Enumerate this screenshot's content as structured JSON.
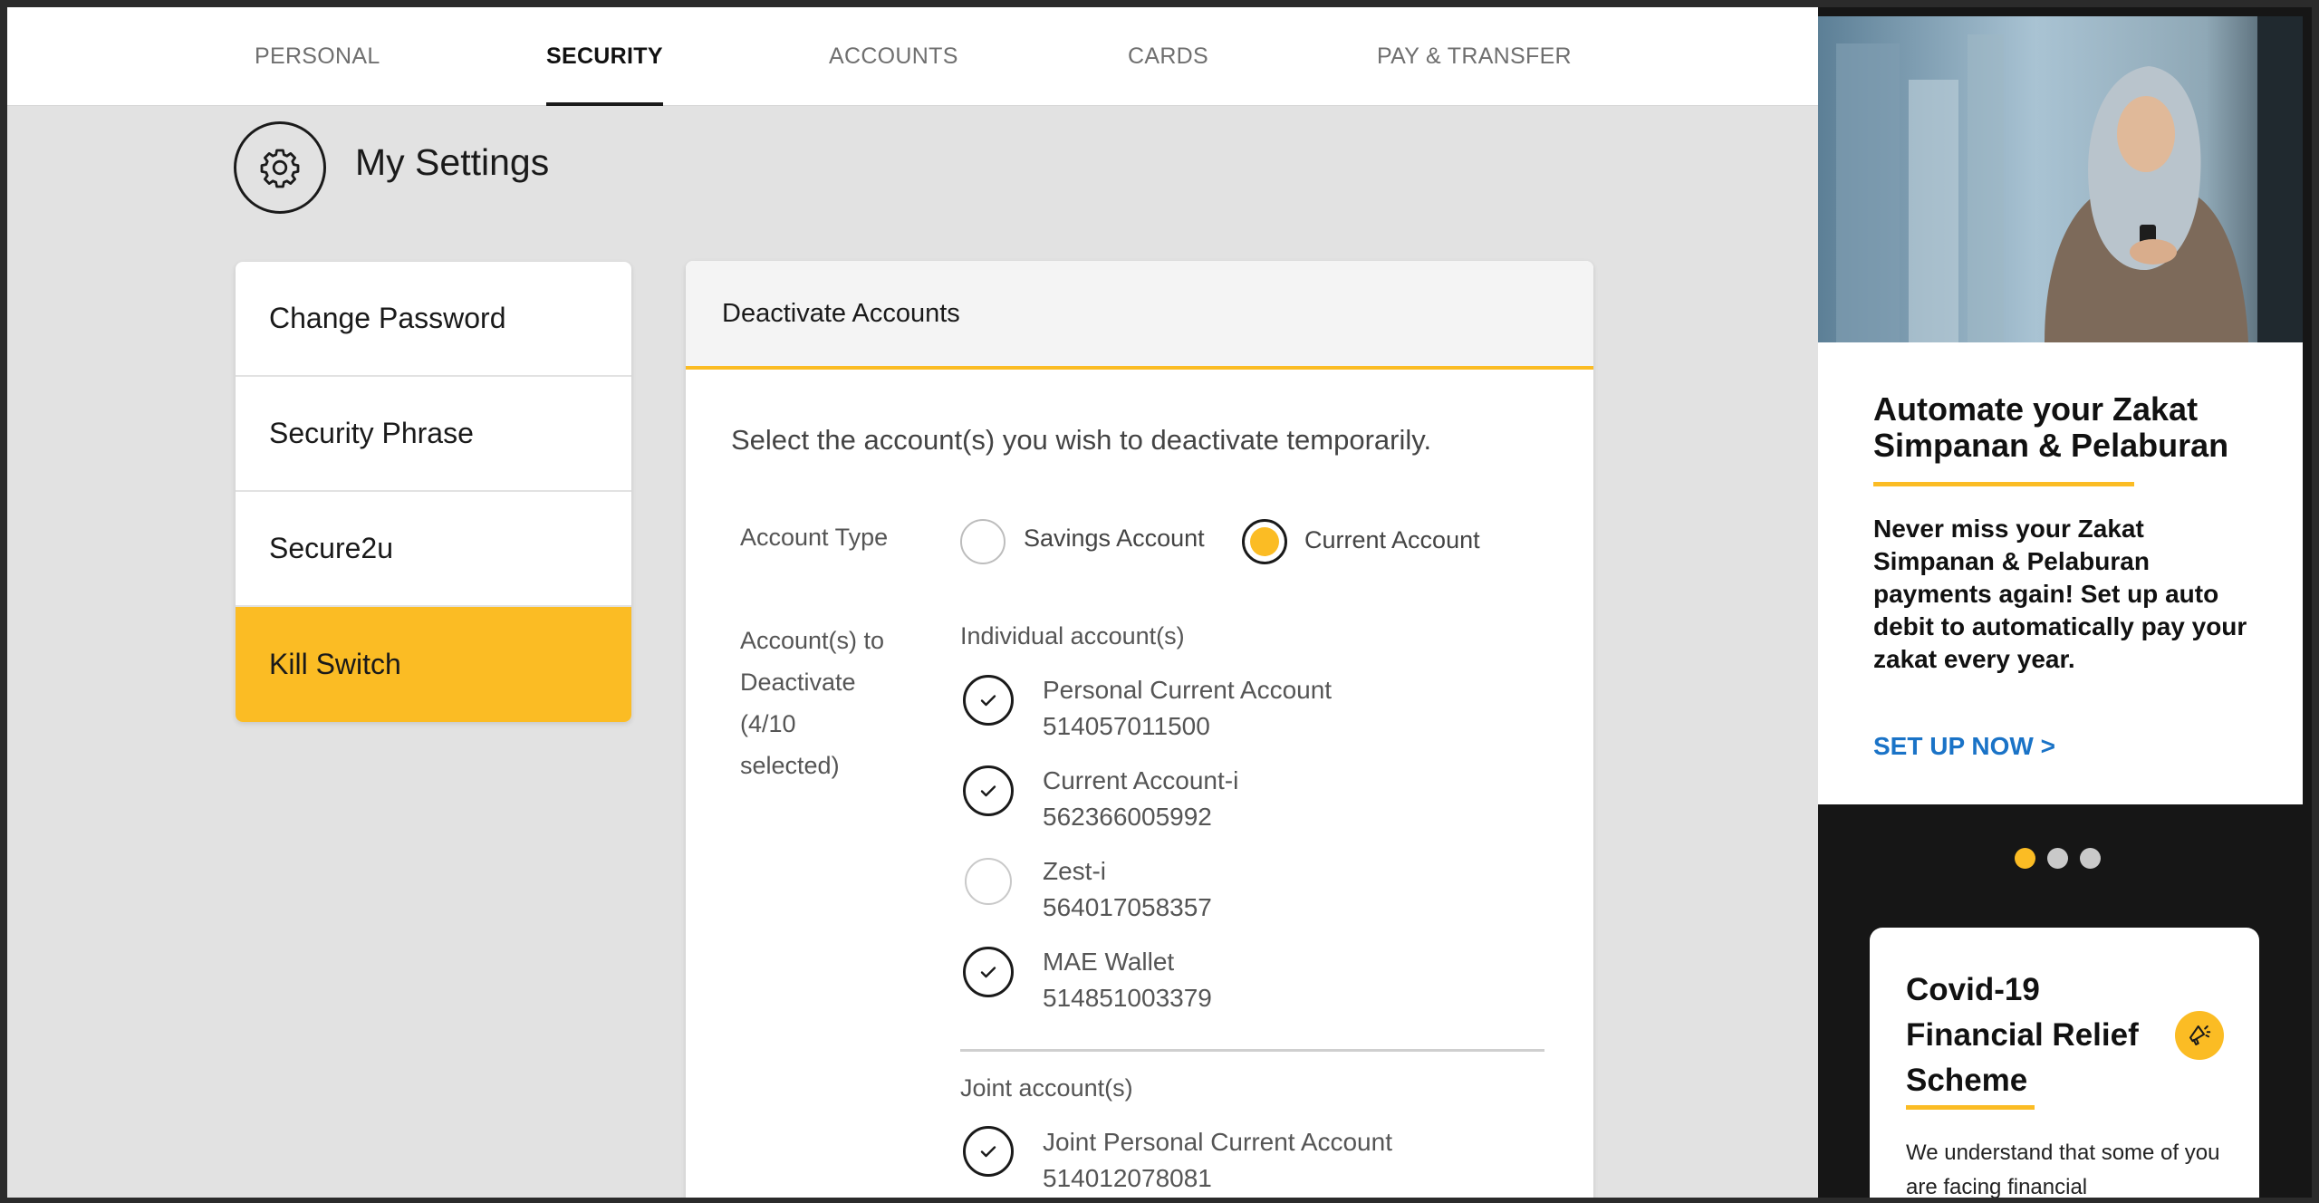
{
  "nav": {
    "tabs": [
      {
        "label": "PERSONAL"
      },
      {
        "label": "SECURITY"
      },
      {
        "label": "ACCOUNTS"
      },
      {
        "label": "CARDS"
      },
      {
        "label": "PAY & TRANSFER"
      }
    ],
    "active_tab": "SECURITY"
  },
  "settings": {
    "title": "My Settings",
    "icon": "gear-icon"
  },
  "sidebar": {
    "items": [
      {
        "label": "Change Password"
      },
      {
        "label": "Security Phrase"
      },
      {
        "label": "Secure2u"
      },
      {
        "label": "Kill Switch"
      }
    ],
    "active_item": "Kill Switch"
  },
  "panel": {
    "title": "Deactivate Accounts",
    "instruction": "Select the account(s) you wish to deactivate temporarily.",
    "account_type_label": "Account Type",
    "account_types": [
      {
        "label": "Savings Account",
        "selected": false
      },
      {
        "label": "Current Account",
        "selected": true
      }
    ],
    "deactivate_label": [
      "Account(s) to",
      "Deactivate",
      "(4/10",
      "selected)"
    ],
    "individual_heading": "Individual account(s)",
    "individual_accounts": [
      {
        "name": "Personal Current Account",
        "number": "514057011500",
        "checked": true
      },
      {
        "name": "Current Account-i",
        "number": "562366005992",
        "checked": true
      },
      {
        "name": "Zest-i",
        "number": "564017058357",
        "checked": false
      },
      {
        "name": "MAE Wallet",
        "number": "514851003379",
        "checked": true
      }
    ],
    "joint_heading": "Joint account(s)",
    "joint_accounts": [
      {
        "name": "Joint Personal Current Account",
        "number": "514012078081",
        "checked": true
      }
    ]
  },
  "ad": {
    "title": "Automate your Zakat Simpanan & Pelaburan",
    "body": "Never miss your Zakat Simpanan & Pelaburan payments again! Set up auto debit to automatically pay your zakat every year.",
    "cta": "SET UP NOW >",
    "carousel_active": 0,
    "carousel_count": 3
  },
  "covid": {
    "title": "Covid-19 Financial Relief Scheme",
    "body": "We understand that some of you are facing financial",
    "icon": "megaphone-icon"
  },
  "colors": {
    "accent": "#fbbc24",
    "link": "#1a73c7",
    "background": "#e2e2e2"
  }
}
